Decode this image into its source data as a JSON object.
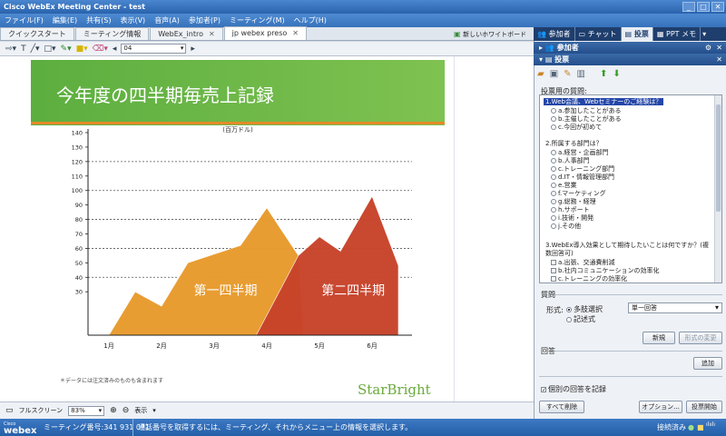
{
  "window": {
    "title": "Cisco WebEx Meeting Center - test",
    "controls": [
      "_",
      "□",
      "✕"
    ]
  },
  "menu": [
    "ファイル(F)",
    "編集(E)",
    "共有(S)",
    "表示(V)",
    "音声(A)",
    "参加者(P)",
    "ミーティング(M)",
    "ヘルプ(H)"
  ],
  "tabs": [
    {
      "label": "クイックスタート",
      "active": false
    },
    {
      "label": "ミーティング情報",
      "active": false
    },
    {
      "label": "WebEx_intro",
      "active": false
    },
    {
      "label": "jp webex preso",
      "active": true
    }
  ],
  "new_whiteboard_label": "新しいホワイトボード",
  "toolbar": {
    "page_value": "04"
  },
  "slide": {
    "title": "今年度の四半期毎売上記録",
    "footnote": "＊データには注文済みのものも含まれます",
    "brand": "StarBright"
  },
  "chart_data": {
    "type": "area",
    "subtitle": "(百万ドル)",
    "categories": [
      "1月",
      "2月",
      "3月",
      "4月",
      "5月",
      "6月"
    ],
    "yticks": [
      30,
      40,
      50,
      60,
      70,
      80,
      90,
      100,
      110,
      120,
      130,
      140
    ],
    "ylim": [
      0,
      140
    ],
    "grid_dashed_at": [
      40,
      60,
      80,
      100,
      120
    ],
    "series": [
      {
        "name": "第一四半期",
        "color": "#e89a2c",
        "points": [
          [
            0,
            0
          ],
          [
            0.5,
            30
          ],
          [
            1,
            20
          ],
          [
            1.5,
            50
          ],
          [
            2.5,
            62
          ],
          [
            3,
            88
          ],
          [
            3.6,
            55
          ],
          [
            3.7,
            0
          ]
        ]
      },
      {
        "name": "第二四半期",
        "color": "#c8432a",
        "points": [
          [
            2.8,
            0
          ],
          [
            3.6,
            55
          ],
          [
            4,
            68
          ],
          [
            4.4,
            58
          ],
          [
            5,
            96
          ],
          [
            5.5,
            48
          ],
          [
            5.5,
            0
          ]
        ]
      }
    ]
  },
  "bottombar": {
    "fullscreen_label": "フルスクリーン",
    "zoom": "83%",
    "view_label": "表示"
  },
  "status": {
    "logo_small": "Cisco",
    "logo_big": "webex",
    "meeting_number": "ミーティング番号:341 931 071",
    "message": "通話番号を取得するには、ミーティング、それからメニュー上の情報を選択します。",
    "connection": "接続済み"
  },
  "right_panel": {
    "tabs": [
      "参加者",
      "チャット",
      "投票",
      "PPT メモ"
    ],
    "participants_header": "参加者",
    "poll_header": "投票",
    "questions_label": "投票用の質問:",
    "questions": [
      {
        "text": "1.Web会議、Webセミナーのご経験は？",
        "highlight": true,
        "type": "radio",
        "options": [
          "a.参加したことがある",
          "b.主催したことがある",
          "c.今回が初めて"
        ]
      },
      {
        "text": "2.所属する部門は？",
        "highlight": false,
        "type": "radio",
        "options": [
          "a.経営・企画部門",
          "b.人事部門",
          "c.トレーニング部門",
          "d.IT・情報管理部門",
          "e.営業",
          "f.マーケティング",
          "g.総務・経理",
          "h.サポート",
          "i.技術・開発",
          "j.その他"
        ]
      },
      {
        "text": "3.WebEx導入効果として期待したいことは何ですか？(複",
        "text2": "数回答可)",
        "highlight": false,
        "type": "check",
        "options": [
          "a.出張、交通費削減",
          "b.社内コミュニケーションの効率化",
          "c.トレーニングの効率化"
        ]
      }
    ],
    "question_section": "質問",
    "format_label": "形式:",
    "format_options": [
      "多肢選択",
      "記述式"
    ],
    "answer_type": "単一回答",
    "new_button": "新規",
    "change_format_button": "形式の変更",
    "answer_section": "回答",
    "add_button": "追加",
    "record_label": "個別の回答を記録",
    "clear_all_button": "すべて削除",
    "options_button": "オプション...",
    "start_poll_button": "投票開始"
  }
}
